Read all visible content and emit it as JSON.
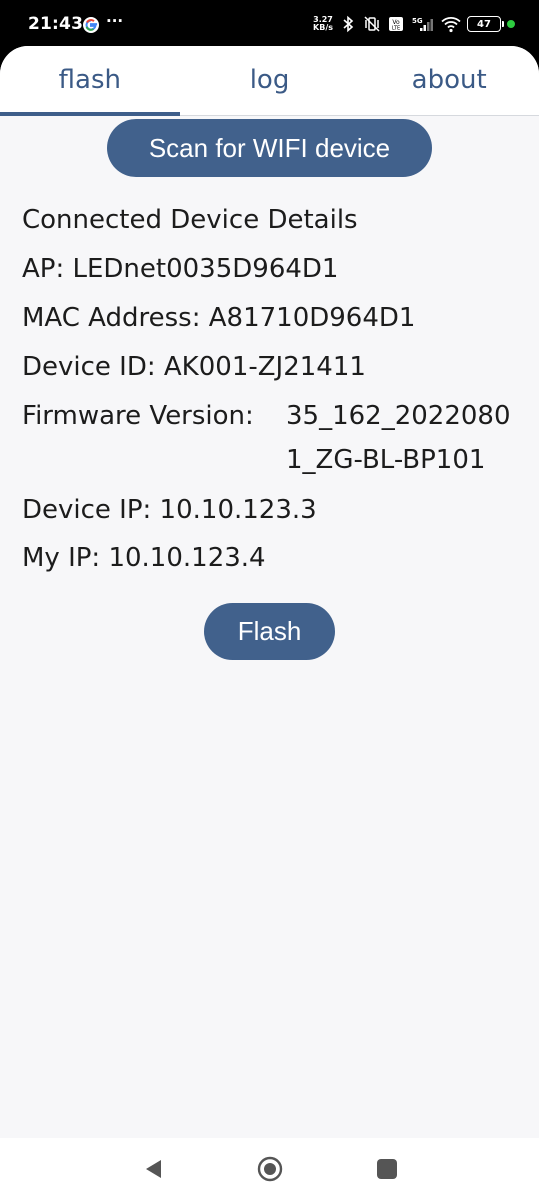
{
  "status": {
    "time": "21:43",
    "more": "···",
    "net_speed_value": "3.27",
    "net_speed_unit": "KB/s",
    "battery": "47",
    "icons": [
      "google-icon",
      "bluetooth-icon",
      "vibrate-off-icon",
      "volte-icon",
      "5g-signal-icon",
      "wifi-icon",
      "battery-icon"
    ]
  },
  "tabs": [
    {
      "label": "flash",
      "active": true
    },
    {
      "label": "log",
      "active": false
    },
    {
      "label": "about",
      "active": false
    }
  ],
  "scan_button": "Scan for WIFI device",
  "details": {
    "heading": "Connected Device Details",
    "ap": "AP: LEDnet0035D964D1",
    "mac": "MAC Address: A81710D964D1",
    "device_id": "Device ID: AK001-ZJ21411",
    "firmware_label": "Firmware Version:",
    "firmware_value": "35_162_20220801_ZG-BL-BP101",
    "device_ip": "Device IP: 10.10.123.3",
    "my_ip": "My IP: 10.10.123.4"
  },
  "flash_button": "Flash",
  "colors": {
    "accent": "#41618c",
    "tab_text": "#3b5a86",
    "background": "#f7f7f9",
    "status_dot": "#2ecc40"
  }
}
